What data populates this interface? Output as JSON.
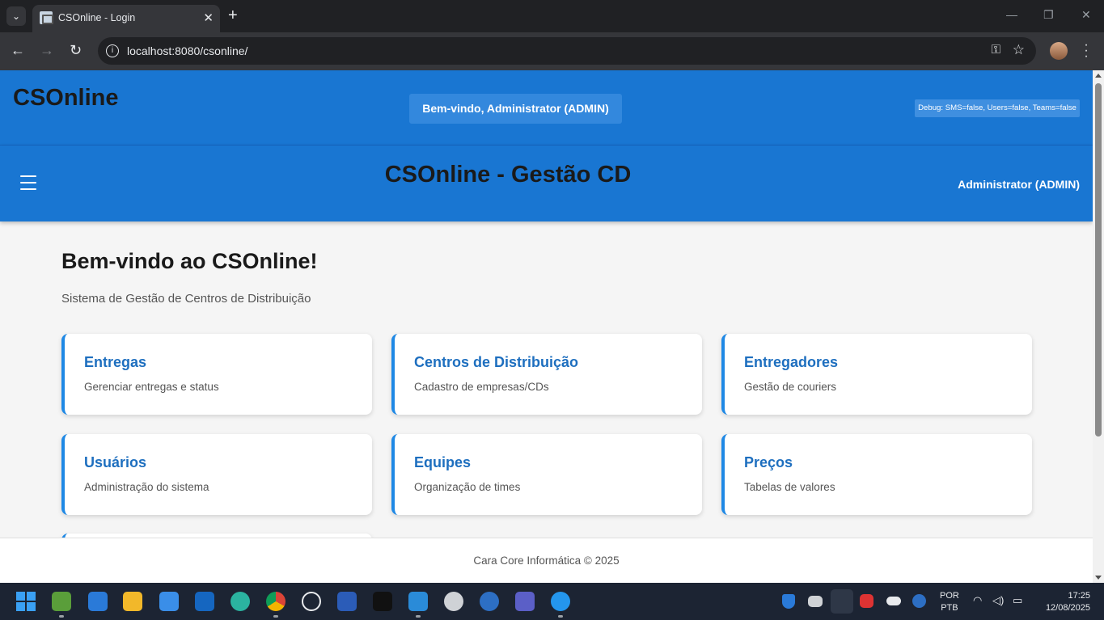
{
  "browser": {
    "tab_title": "CSOnline - Login",
    "tab_close": "✕",
    "new_tab": "+",
    "url": "localhost:8080/csonline/",
    "back": "←",
    "forward": "→",
    "reload": "↻",
    "star": "☆",
    "key": "⚿",
    "window_min": "—",
    "window_max": "❐",
    "window_close": "✕"
  },
  "app": {
    "brand": "CSOnline",
    "welcome_badge": "Bem-vindo, Administrator (ADMIN)",
    "debug_badge": "Debug: SMS=false, Users=false, Teams=false",
    "nav_title": "CSOnline - Gestão CD",
    "nav_user": "Administrator (ADMIN)"
  },
  "main": {
    "heading": "Bem-vindo ao CSOnline!",
    "subheading": "Sistema de Gestão de Centros de Distribuição",
    "cards": [
      {
        "title": "Entregas",
        "desc": "Gerenciar entregas e status"
      },
      {
        "title": "Centros de Distribuição",
        "desc": "Cadastro de empresas/CDs"
      },
      {
        "title": "Entregadores",
        "desc": "Gestão de couriers"
      },
      {
        "title": "Usuários",
        "desc": "Administração do sistema"
      },
      {
        "title": "Equipes",
        "desc": "Organização de times"
      },
      {
        "title": "Preços",
        "desc": "Tabelas de valores"
      }
    ]
  },
  "footer": {
    "text": "Cara Core Informática © 2025"
  },
  "taskbar": {
    "lang_top": "POR",
    "lang_bottom": "PTB",
    "time": "17:25",
    "date": "12/08/2025",
    "icons": [
      "windows-start-icon",
      "notepad-icon",
      "notes-icon",
      "file-explorer-icon",
      "store-icon",
      "outlook-icon",
      "edge-icon",
      "chrome-icon",
      "chatgpt-icon",
      "word-icon",
      "app-icon",
      "vscode-icon",
      "wildfly-icon",
      "app-dots-icon",
      "teams-icon",
      "docker-icon"
    ]
  }
}
